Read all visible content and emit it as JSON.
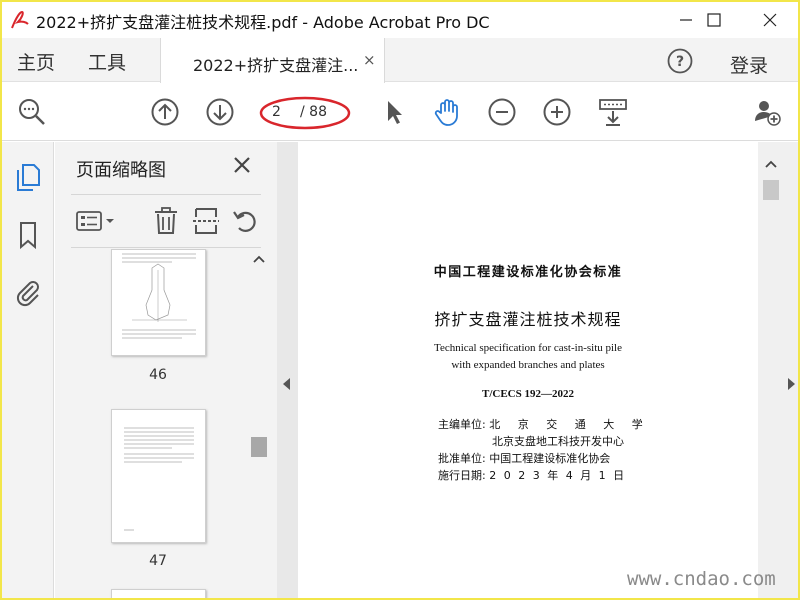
{
  "window": {
    "title": "2022+挤扩支盘灌注桩技术规程.pdf - Adobe Acrobat Pro DC"
  },
  "nav": {
    "home": "主页",
    "tools": "工具",
    "doc_tab": "2022+挤扩支盘灌注...",
    "doc_tab_close": "×",
    "login": "登录"
  },
  "toolbar": {
    "page_current": "2",
    "page_total": "/ 88"
  },
  "panel": {
    "title": "页面缩略图",
    "thumbnails": [
      {
        "page": "46"
      },
      {
        "page": "47"
      }
    ]
  },
  "document": {
    "org_standard": "中国工程建设标准化协会标准",
    "title_cn": "挤扩支盘灌注桩技术规程",
    "title_en_1": "Technical specification for cast-in-situ pile",
    "title_en_2": "with expanded branches and plates",
    "code": "T/CECS 192—2022",
    "editor_label": "主编单位:",
    "editor_1": "北 京 交 通 大 学",
    "editor_2": "北京支盘地工科技开发中心",
    "approver_label": "批准单位:",
    "approver": "中国工程建设标准化协会",
    "date_label": "施行日期:",
    "date": "2 0 2 3 年 4 月 1 日"
  },
  "watermark": "www.cndao.com",
  "colors": {
    "accent_blue": "#2a7bd5",
    "annotation_red": "#d9262c",
    "frame_yellow": "#f2e64a"
  },
  "icons": {
    "app": "acrobat-app-icon",
    "minimize": "minimize-icon",
    "maximize": "maximize-icon",
    "close": "close-icon",
    "help": "help-icon",
    "zoom_search": "zoom-search-icon",
    "prev_page": "arrow-up-circle-icon",
    "next_page": "arrow-down-circle-icon",
    "select": "cursor-arrow-icon",
    "hand": "hand-tool-icon",
    "zoom_out": "zoom-out-icon",
    "zoom_in": "zoom-in-icon",
    "keyboard": "keyboard-scroll-icon",
    "add_user": "add-user-icon"
  }
}
